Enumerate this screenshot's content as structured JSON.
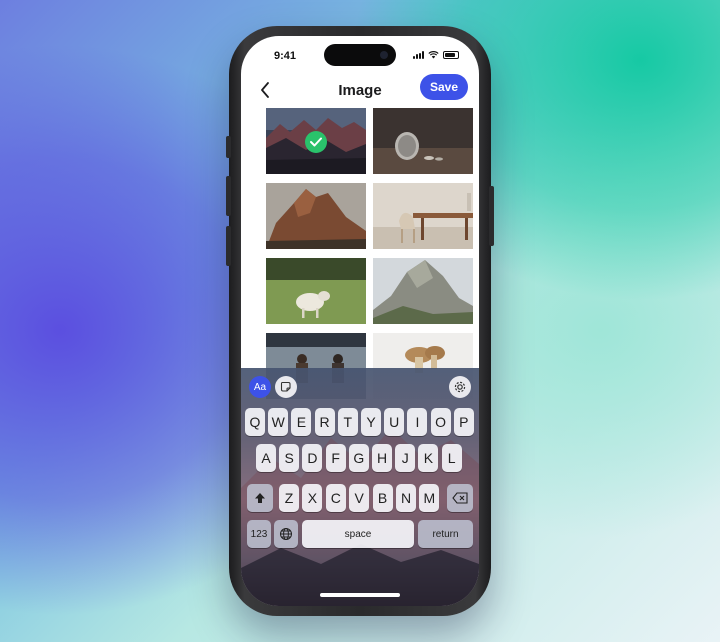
{
  "status_bar": {
    "time": "9:41"
  },
  "header": {
    "title": "Image",
    "save_label": "Save"
  },
  "gallery": {
    "items": [
      {
        "name": "mountain-range-photo",
        "selected": true
      },
      {
        "name": "coin-photo",
        "selected": false
      },
      {
        "name": "rocky-peak-photo",
        "selected": false
      },
      {
        "name": "dining-chair-photo",
        "selected": false
      },
      {
        "name": "sheep-photo",
        "selected": false
      },
      {
        "name": "rock-cliff-photo",
        "selected": false
      },
      {
        "name": "people-lake-photo",
        "selected": false
      },
      {
        "name": "mushrooms-photo",
        "selected": false
      }
    ]
  },
  "keyboard": {
    "aa_label": "Aa",
    "row1": [
      "Q",
      "W",
      "E",
      "R",
      "T",
      "Y",
      "U",
      "I",
      "O",
      "P"
    ],
    "row2": [
      "A",
      "S",
      "D",
      "F",
      "G",
      "H",
      "J",
      "K",
      "L"
    ],
    "row3": [
      "Z",
      "X",
      "C",
      "V",
      "B",
      "N",
      "M"
    ],
    "numbers_label": "123",
    "space_label": "space",
    "return_label": "return"
  },
  "colors": {
    "accent": "#3d52e8",
    "check": "#2ac26b"
  }
}
